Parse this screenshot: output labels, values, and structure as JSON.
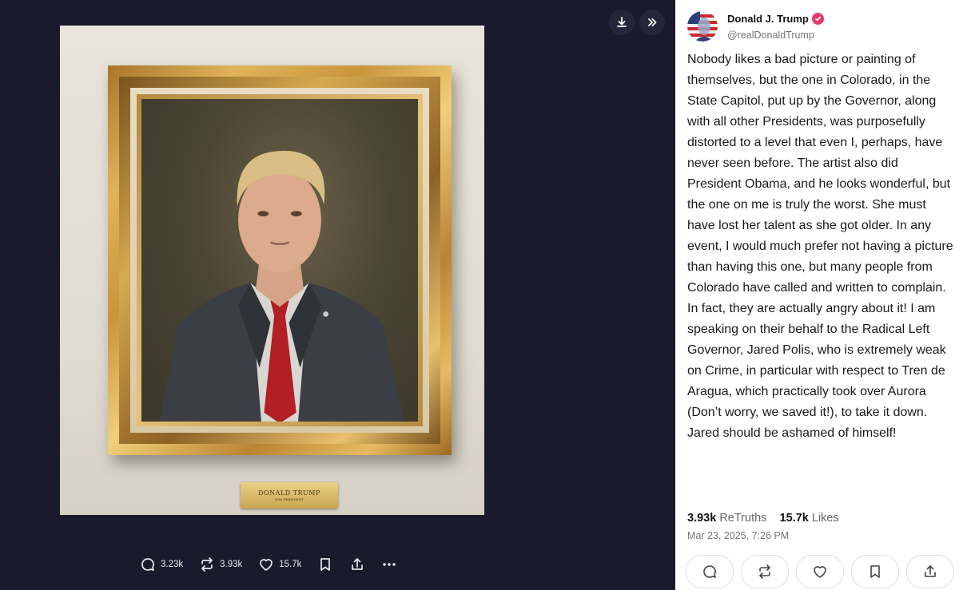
{
  "viewer": {
    "top_buttons": [
      {
        "icon": "download-icon"
      },
      {
        "icon": "expand-panel-icon"
      }
    ],
    "plaque": {
      "name": "DONALD TRUMP",
      "sub": "45th PRESIDENT"
    },
    "actions": {
      "reply_count": "3.23k",
      "retruth_count": "3.93k",
      "like_count": "15.7k"
    }
  },
  "post": {
    "author_name": "Donald J. Trump",
    "author_handle": "@realDonaldTrump",
    "text": "Nobody likes a bad picture or painting of themselves, but the one in Colorado, in the State Capitol, put up by the Governor, along with all other Presidents, was purposefully distorted to a level that even I, perhaps, have never seen before. The artist also did President Obama, and he looks wonderful, but the one on me is truly the worst. She must have lost her talent as she got older. In any event, I would much prefer not having a picture than having this one, but many people from Colorado have called and written to complain. In fact, they are actually angry about it! I am speaking on their behalf to the Radical Left Governor, Jared Polis, who is extremely weak on Crime, in particular with respect to Tren de Aragua, which practically took over Aurora (Don’t worry, we saved it!), to take it down. Jared should be ashamed of himself!",
    "retruths_count": "3.93k",
    "retruths_label": "ReTruths",
    "likes_count": "15.7k",
    "likes_label": "Likes",
    "timestamp": "Mar 23, 2025, 7:26 PM"
  },
  "colors": {
    "verified": "#e23a6a",
    "viewer_bg": "#1b1a2c",
    "panel_bg": "#ffffff"
  }
}
